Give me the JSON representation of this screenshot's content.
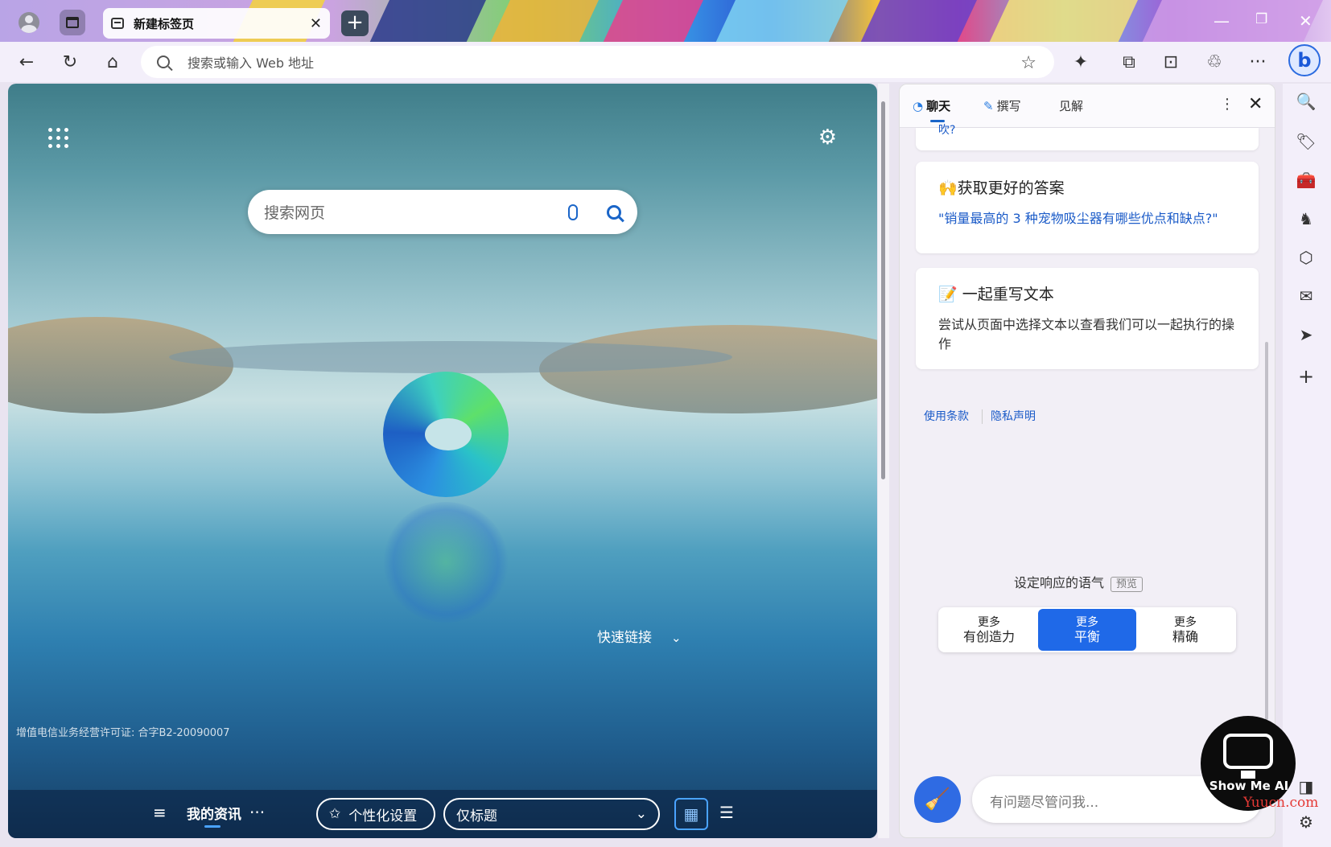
{
  "browser": {
    "tab_title": "新建标签页",
    "new_tab_icon": "+",
    "address_placeholder": "搜索或输入 Web 地址"
  },
  "newtab": {
    "search_placeholder": "搜索网页",
    "quick_links": "快速链接",
    "license": "增值电信业务经营许可证: 合字B2-20090007",
    "bottom": {
      "news": "我的资讯",
      "more": "···",
      "personalize": "个性化设置",
      "layout_select": "仅标题"
    }
  },
  "copilot": {
    "tabs": [
      {
        "label": "聊天"
      },
      {
        "label": "撰写"
      },
      {
        "label": "见解"
      }
    ],
    "truncated_text": "吹?",
    "cards": [
      {
        "emoji": "🙌",
        "title": "获取更好的答案",
        "body": "\"销量最高的 3 种宠物吸尘器有哪些优点和缺点?\""
      },
      {
        "emoji": "📝",
        "title": "一起重写文本",
        "body": "尝试从页面中选择文本以查看我们可以一起执行的操作"
      }
    ],
    "links": [
      "使用条款",
      "隐私声明"
    ],
    "tone_label": "设定响应的语气",
    "tone_preview": "预览",
    "tones": [
      {
        "line1": "更多",
        "line2": "有创造力"
      },
      {
        "line1": "更多",
        "line2": "平衡"
      },
      {
        "line1": "更多",
        "line2": "精确"
      }
    ],
    "ask_placeholder": "有问题尽管问我..."
  },
  "watermark": {
    "brand": "Show Me AI",
    "site": "Yuucn.com"
  },
  "colors": {
    "accent": "#1f69e8",
    "link": "#1b5bc8"
  }
}
